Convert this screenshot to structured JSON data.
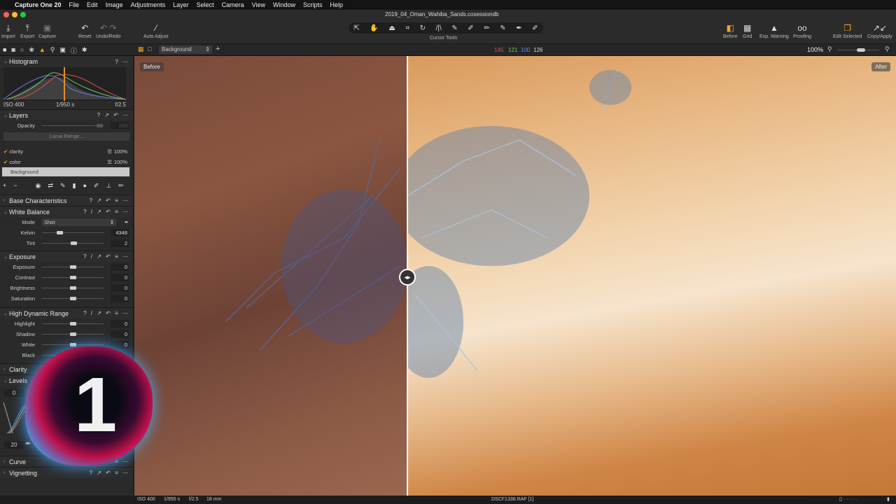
{
  "menu": {
    "app": "Capture One 20",
    "items": [
      "File",
      "Edit",
      "Image",
      "Adjustments",
      "Layer",
      "Select",
      "Camera",
      "View",
      "Window",
      "Scripts",
      "Help"
    ]
  },
  "window": {
    "title": "2019_04_Oman_Wahiba_Sands.cosessiondb"
  },
  "toolbar": {
    "import": "Import",
    "export": "Export",
    "capture": "Capture",
    "reset": "Reset",
    "undo_redo": "Undo/Redo",
    "auto_adjust": "Auto Adjust",
    "cursor_tools": "Cursor Tools",
    "before": "Before",
    "grid": "Grid",
    "exp_warning": "Exp. Warning",
    "proofing": "Proofing",
    "edit_selected": "Edit Selected",
    "copy_apply": "Copy/Apply"
  },
  "viewer_bar": {
    "layer": "Background",
    "rgb": {
      "r": "145",
      "g": "121",
      "b": "100",
      "l": "126"
    },
    "zoom": "100%"
  },
  "histogram": {
    "title": "Histogram",
    "iso": "ISO 400",
    "shutter": "1/950 s",
    "aperture": "f/2.5"
  },
  "layers": {
    "title": "Layers",
    "opacity_label": "Opacity",
    "opacity_value": "100",
    "luma": "Luma Range...",
    "items": [
      {
        "name": "clarity",
        "value": "100%"
      },
      {
        "name": "color",
        "value": "100%"
      }
    ],
    "background": "Background"
  },
  "base": {
    "title": "Base Characteristics"
  },
  "wb": {
    "title": "White Balance",
    "mode_label": "Mode",
    "mode": "Shot",
    "kelvin_label": "Kelvin",
    "kelvin": "4348",
    "tint_label": "Tint",
    "tint": "2"
  },
  "exposure": {
    "title": "Exposure",
    "rows": [
      {
        "label": "Exposure",
        "value": "0"
      },
      {
        "label": "Contrast",
        "value": "0"
      },
      {
        "label": "Brightness",
        "value": "0"
      },
      {
        "label": "Saturation",
        "value": "0"
      }
    ]
  },
  "hdr": {
    "title": "High Dynamic Range",
    "rows": [
      {
        "label": "Highlight",
        "value": "0"
      },
      {
        "label": "Shadow",
        "value": "0"
      },
      {
        "label": "White",
        "value": "0"
      },
      {
        "label": "Black",
        "value": ""
      }
    ]
  },
  "clarity": {
    "title": "Clarity"
  },
  "levels": {
    "title": "Levels",
    "top": "0",
    "bottom": "20"
  },
  "curve": {
    "title": "Curve"
  },
  "vignetting": {
    "title": "Vignetting"
  },
  "viewer": {
    "before": "Before",
    "after": "After"
  },
  "logo": {
    "text": "1"
  },
  "status": {
    "iso": "ISO 400",
    "shutter": "1/950 s",
    "aperture": "f/2.5",
    "focal": "18 mm",
    "file": "DSCF1338.RAF [1]"
  }
}
